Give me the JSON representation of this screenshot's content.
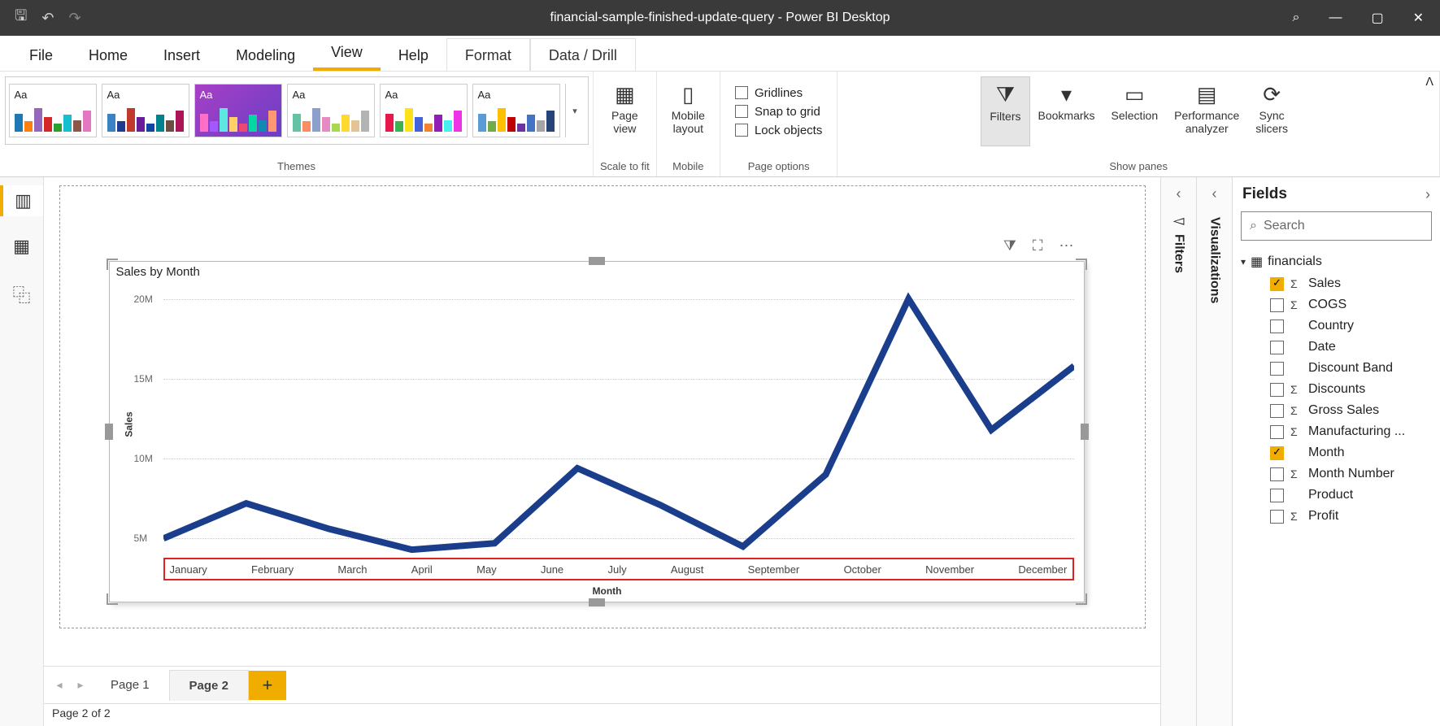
{
  "title": "financial-sample-finished-update-query - Power BI Desktop",
  "menu": {
    "file": "File",
    "home": "Home",
    "insert": "Insert",
    "modeling": "Modeling",
    "view": "View",
    "help": "Help",
    "format": "Format",
    "datadrill": "Data / Drill"
  },
  "ribbon": {
    "themes_label": "Themes",
    "scale_label": "Scale to fit",
    "page_view": "Page\nview",
    "mobile_layout": "Mobile\nlayout",
    "mobile_label": "Mobile",
    "gridlines": "Gridlines",
    "snap": "Snap to grid",
    "lock": "Lock objects",
    "page_options_label": "Page options",
    "filters": "Filters",
    "bookmarks": "Bookmarks",
    "selection": "Selection",
    "perf": "Performance\nanalyzer",
    "sync": "Sync\nslicers",
    "show_panes_label": "Show panes"
  },
  "panes": {
    "filters": "Filters",
    "viz": "Visualizations",
    "fields": "Fields",
    "search": "Search"
  },
  "fields_table": {
    "name": "financials",
    "fields": [
      {
        "label": "Sales",
        "checked": true,
        "sigma": true
      },
      {
        "label": "COGS",
        "checked": false,
        "sigma": true
      },
      {
        "label": "Country",
        "checked": false,
        "sigma": false
      },
      {
        "label": "Date",
        "checked": false,
        "sigma": false
      },
      {
        "label": "Discount Band",
        "checked": false,
        "sigma": false
      },
      {
        "label": "Discounts",
        "checked": false,
        "sigma": true
      },
      {
        "label": "Gross Sales",
        "checked": false,
        "sigma": true
      },
      {
        "label": "Manufacturing ...",
        "checked": false,
        "sigma": true
      },
      {
        "label": "Month",
        "checked": true,
        "sigma": false
      },
      {
        "label": "Month Number",
        "checked": false,
        "sigma": true
      },
      {
        "label": "Product",
        "checked": false,
        "sigma": false
      },
      {
        "label": "Profit",
        "checked": false,
        "sigma": true
      }
    ]
  },
  "page_tabs": {
    "p1": "Page 1",
    "p2": "Page 2"
  },
  "status": "Page 2 of 2",
  "chart": {
    "title": "Sales by Month",
    "xlabel": "Month",
    "ylabel": "Sales",
    "yticks": [
      "20M",
      "15M",
      "10M",
      "5M"
    ]
  },
  "chart_data": {
    "type": "line",
    "title": "Sales by Month",
    "xlabel": "Month",
    "ylabel": "Sales",
    "categories": [
      "January",
      "February",
      "March",
      "April",
      "May",
      "June",
      "July",
      "August",
      "September",
      "October",
      "November",
      "December"
    ],
    "values": [
      5000000,
      7200000,
      5600000,
      4300000,
      4700000,
      9400000,
      7100000,
      4500000,
      9000000,
      20000000,
      11800000,
      15800000
    ],
    "ylim": [
      4000000,
      21000000
    ],
    "yticks": [
      5000000,
      10000000,
      15000000,
      20000000
    ]
  }
}
